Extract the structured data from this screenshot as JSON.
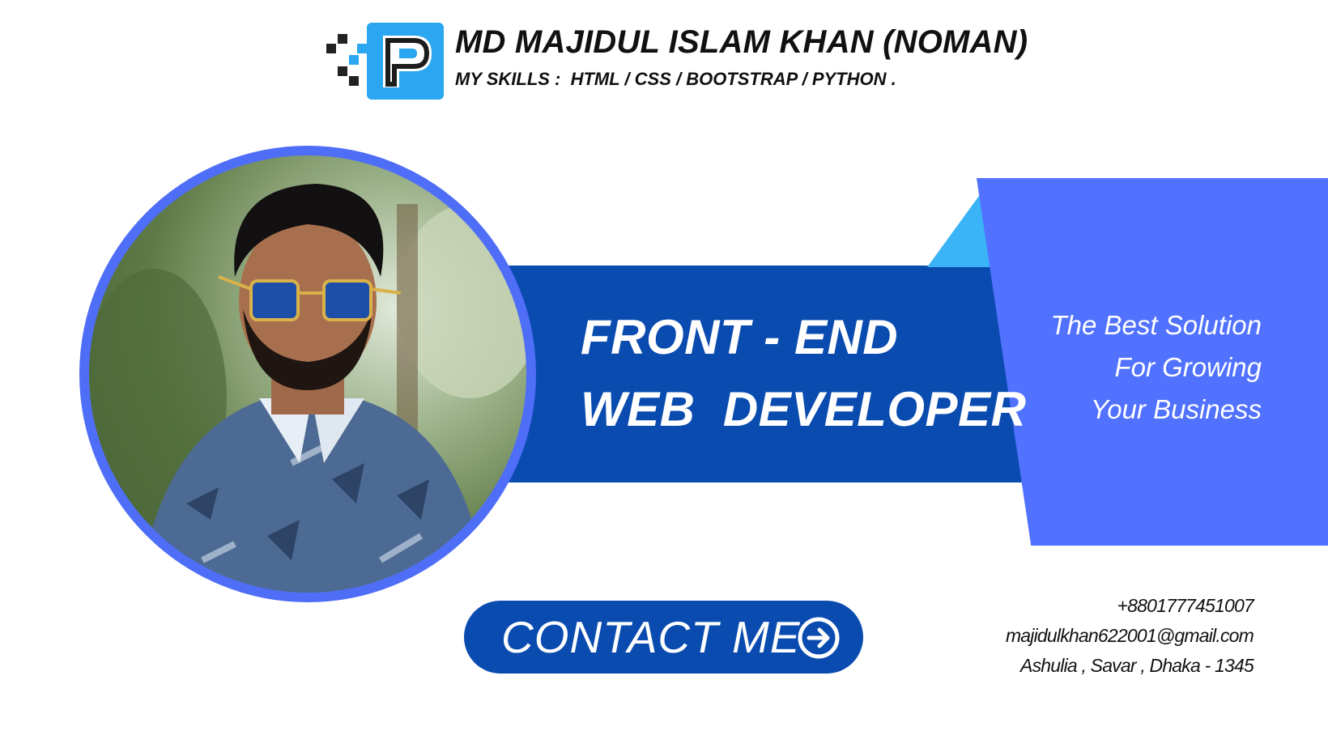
{
  "header": {
    "name": "MD MAJIDUL ISLAM KHAN (NOMAN)",
    "skills": "MY SKILLS :  HTML / CSS / BOOTSTRAP / PYTHON ."
  },
  "logo": {
    "letter": "P",
    "icon": "p-letter-logo-icon"
  },
  "role": {
    "line1": "FRONT - END",
    "line2": "WEB  DEVELOPER"
  },
  "tagline": [
    "The Best Solution",
    "For Growing",
    "Your Business"
  ],
  "contact": {
    "button_label": "CONTACT ME",
    "button_icon": "arrow-right-circle-icon",
    "phone": "+8801777451007",
    "email": "majidulkhan622001@gmail.com",
    "address": "Ashulia , Savar , Dhaka - 1345"
  },
  "colors": {
    "dark_blue": "#0a4bb0",
    "medium_blue": "#5171ff",
    "light_blue": "#3ab4f7",
    "photo_ring": "#4f6ef7",
    "logo_blue": "#2aa7f0",
    "text_dark": "#111111"
  }
}
